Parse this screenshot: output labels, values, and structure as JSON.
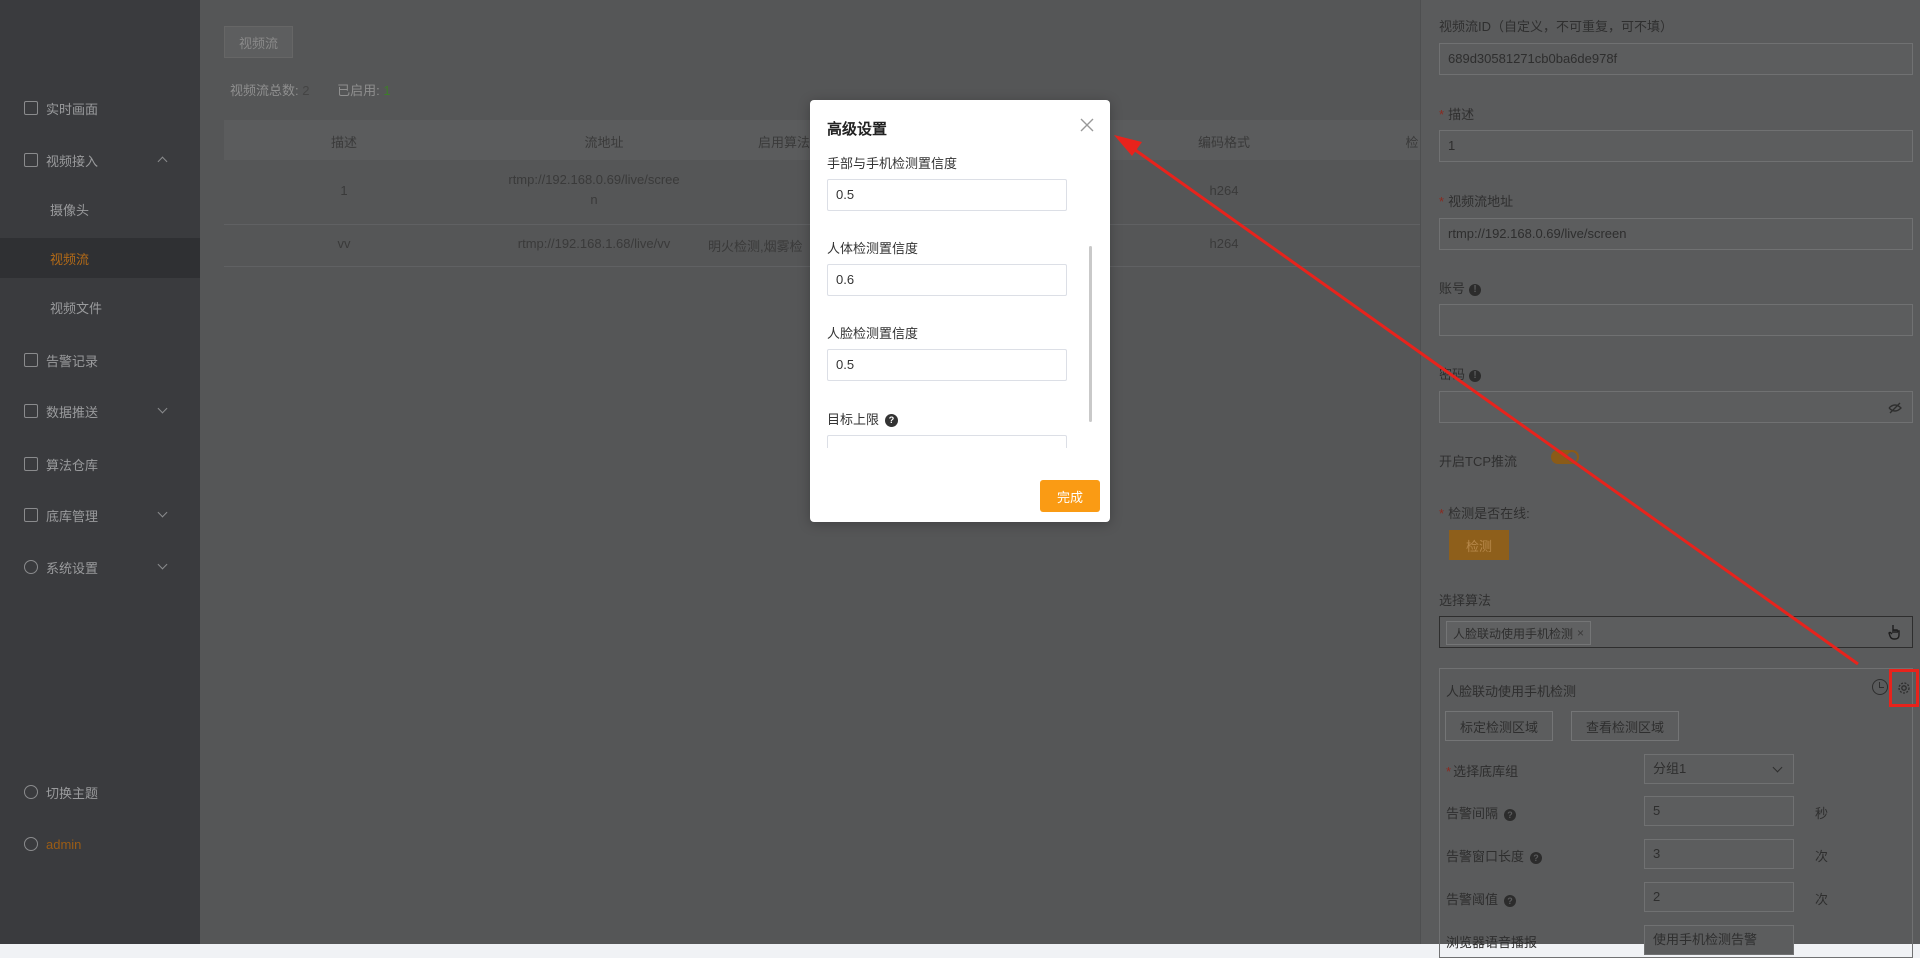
{
  "sidebar": {
    "items": [
      {
        "label": "实时画面"
      },
      {
        "label": "视频接入"
      },
      {
        "label": "摄像头"
      },
      {
        "label": "视频流"
      },
      {
        "label": "视频文件"
      },
      {
        "label": "告警记录"
      },
      {
        "label": "数据推送"
      },
      {
        "label": "算法仓库"
      },
      {
        "label": "底库管理"
      },
      {
        "label": "系统设置"
      }
    ],
    "theme_label": "切换主题",
    "user": "admin"
  },
  "main": {
    "tab": "视频流",
    "stats": {
      "total_label": "视频流总数:",
      "total": "2",
      "enabled_label": "已启用:",
      "enabled": "1"
    },
    "columns": [
      "描述",
      "流地址",
      "启用算法",
      "编码格式",
      "检"
    ],
    "rows": [
      {
        "desc": "1",
        "url": "rtmp://192.168.0.69/live/scree",
        "url2": "n",
        "algo": "",
        "codec": "h264"
      },
      {
        "desc": "vv",
        "url": "rtmp://192.168.1.68/live/vv",
        "url2": "",
        "algo": "明火检测,烟雾检",
        "codec": "h264"
      }
    ]
  },
  "drawer": {
    "id_label": "视频流ID（自定义，不可重复，可不填）",
    "id_value": "689d30581271cb0ba6de978f",
    "desc_label": "描述",
    "desc_value": "1",
    "url_label": "视频流地址",
    "url_value": "rtmp://192.168.0.69/live/screen",
    "account_label": "账号",
    "password_label": "密码",
    "tcp_label": "开启TCP推流",
    "tcp_enabled": true,
    "online_label": "检测是否在线:",
    "detect_button": "检测",
    "algo_label": "选择算法",
    "algo_tag": "人脸联动使用手机检测",
    "card": {
      "title": "人脸联动使用手机检测",
      "btn_mark": "标定检测区域",
      "btn_view": "查看检测区域",
      "group_label": "选择底库组",
      "group_value": "分组1",
      "interval_label": "告警间隔",
      "interval_value": "5",
      "interval_unit": "秒",
      "window_label": "告警窗口长度",
      "window_value": "3",
      "window_unit": "次",
      "threshold_label": "告警阈值",
      "threshold_value": "2",
      "threshold_unit": "次",
      "voice_label": "浏览器语音播报",
      "voice_value": "使用手机检测告警"
    }
  },
  "modal": {
    "title": "高级设置",
    "fields": [
      {
        "label": "手部与手机检测置信度",
        "value": "0.5"
      },
      {
        "label": "人体检测置信度",
        "value": "0.6"
      },
      {
        "label": "人脸检测置信度",
        "value": "0.5"
      },
      {
        "label": "目标上限",
        "value": ""
      }
    ],
    "done_button": "完成"
  },
  "colors": {
    "accent": "#fa9b14",
    "annotation": "#e8231c"
  }
}
